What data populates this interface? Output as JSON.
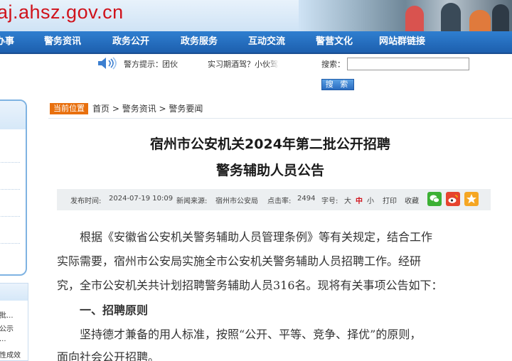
{
  "header": {
    "url_text": "aj.ahsz.gov.cn"
  },
  "nav": {
    "items": [
      "办事",
      "警务资讯",
      "政务公开",
      "政务服务",
      "互动交流",
      "警营文化",
      "网站群链接"
    ]
  },
  "infobar": {
    "tip_label": "警方提示：",
    "tip_text_1": "团伙",
    "tip_text_2": "实习期酒驾？小伙驾",
    "search_label": "搜索：",
    "search_value": "",
    "search_button": "搜 索"
  },
  "sidebar": {
    "items": [
      "批...",
      "公示",
      "...",
      "性成效"
    ]
  },
  "breadcrumb": {
    "badge": "当前位置",
    "home": "首页",
    "sep1": " > ",
    "level2": "警务资讯",
    "sep2": " > ",
    "level3": "警务要闻"
  },
  "article": {
    "title_line1": "宿州市公安机关2024年第二批公开招聘",
    "title_line2": "警务辅助人员公告",
    "meta": {
      "publish_label": "发布时间:",
      "publish_time": "2024-07-19 10:09",
      "source_label": "新闻来源:",
      "source": "宿州市公安局",
      "clicks_label": "点击率:",
      "clicks": "2494",
      "fontsize_label": "字号:",
      "font_large": "大",
      "font_medium": "中",
      "font_small": "小",
      "print": "打印",
      "favorite": "收藏"
    },
    "paragraphs": [
      "　　根据《安徽省公安机关警务辅助人员管理条例》等有关规定，结合工作",
      "实际需要，宿州市公安局实施全市公安机关警务辅助人员招聘工作。经研",
      "究，全市公安机关共计划招聘警务辅助人员316名。现将有关事项公告如下：",
      "　　一、招聘原则",
      "　　坚持德才兼备的用人标准，按照“公开、平等、竞争、择优”的原则，",
      "面向社会公开招聘。"
    ]
  },
  "colors": {
    "nav_bg": "#2272c3",
    "badge_bg": "#e8700e",
    "url_red": "#d0121b",
    "wechat": "#3cb034",
    "weibo": "#e6432e",
    "star": "#f5a623",
    "font_medium_red": "#d0121b"
  }
}
